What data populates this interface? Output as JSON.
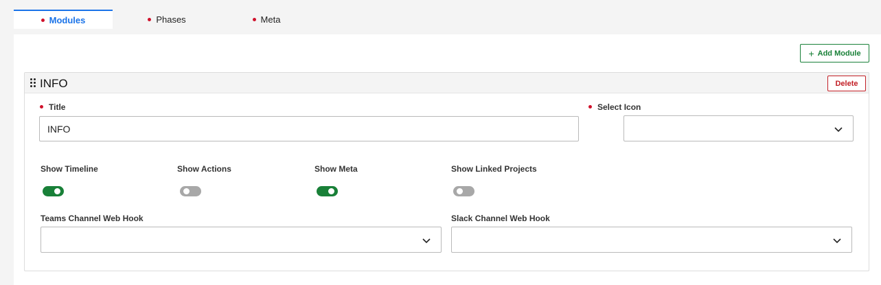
{
  "tabs": [
    {
      "label": "Modules",
      "active": true
    },
    {
      "label": "Phases",
      "active": false
    },
    {
      "label": "Meta",
      "active": false
    }
  ],
  "toolbar": {
    "add_module_label": "Add Module",
    "add_icon": "plus-icon"
  },
  "module": {
    "header_title": "INFO",
    "delete_label": "Delete",
    "title_label": "Title",
    "title_value": "INFO",
    "select_icon_label": "Select Icon",
    "select_icon_value": "",
    "toggles": [
      {
        "label": "Show Timeline",
        "on": true
      },
      {
        "label": "Show Actions",
        "on": false
      },
      {
        "label": "Show Meta",
        "on": true
      },
      {
        "label": "Show Linked Projects",
        "on": false
      }
    ],
    "teams_label": "Teams Channel Web Hook",
    "teams_value": "",
    "slack_label": "Slack Channel Web Hook",
    "slack_value": ""
  },
  "colors": {
    "accent_blue": "#1a73e8",
    "required_red": "#d0112b",
    "success_green": "#198038",
    "danger_red": "#c21e25",
    "toggle_off": "#a8a8a8"
  }
}
